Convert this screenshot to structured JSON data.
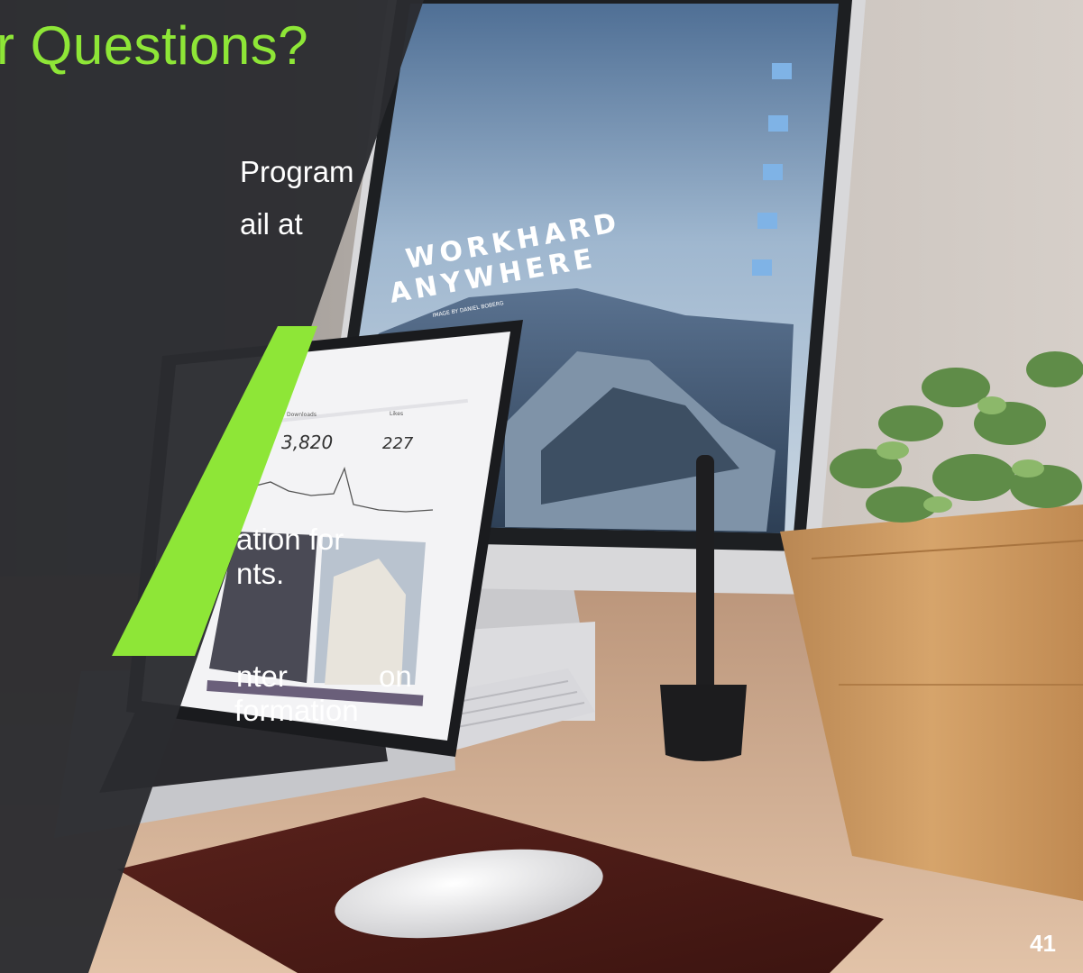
{
  "slide": {
    "title": "r Questions?",
    "page_number": "41",
    "body_lines": [
      "Program",
      "ail at",
      "ation for",
      "nts.",
      "nter",
      "on",
      "formation"
    ]
  },
  "photo": {
    "monitor_wallpaper_line1": "WORKHARD",
    "monitor_wallpaper_line2": "ANYWHERE",
    "monitor_wallpaper_credit": "IMAGE BY DANIEL BOBERG",
    "laptop_stat_downloads_label": "Downloads",
    "laptop_stat_downloads_value": "3,820",
    "laptop_stat_likes_label": "Likes",
    "laptop_stat_likes_value": "227"
  },
  "colors": {
    "accent_green": "#8ee637",
    "panel_dark": "#2b2c30",
    "wall": "#bdb6b0",
    "desk": "#c9a384"
  }
}
